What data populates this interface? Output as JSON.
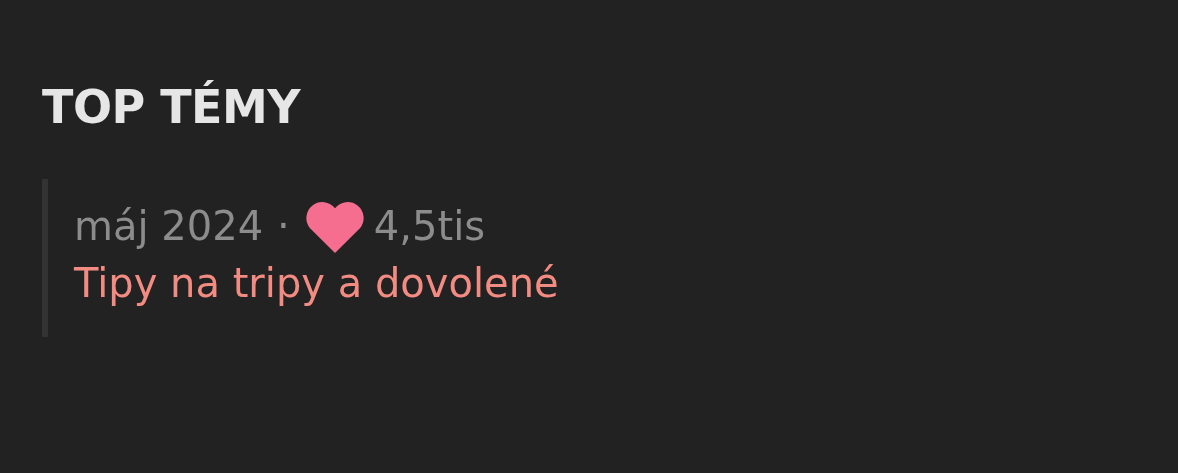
{
  "section": {
    "title": "TOP TÉMY"
  },
  "topics": [
    {
      "date": "máj 2024",
      "separator": "·",
      "likes": "4,5tis",
      "title": "Tipy na tripy a dovolené"
    }
  ]
}
